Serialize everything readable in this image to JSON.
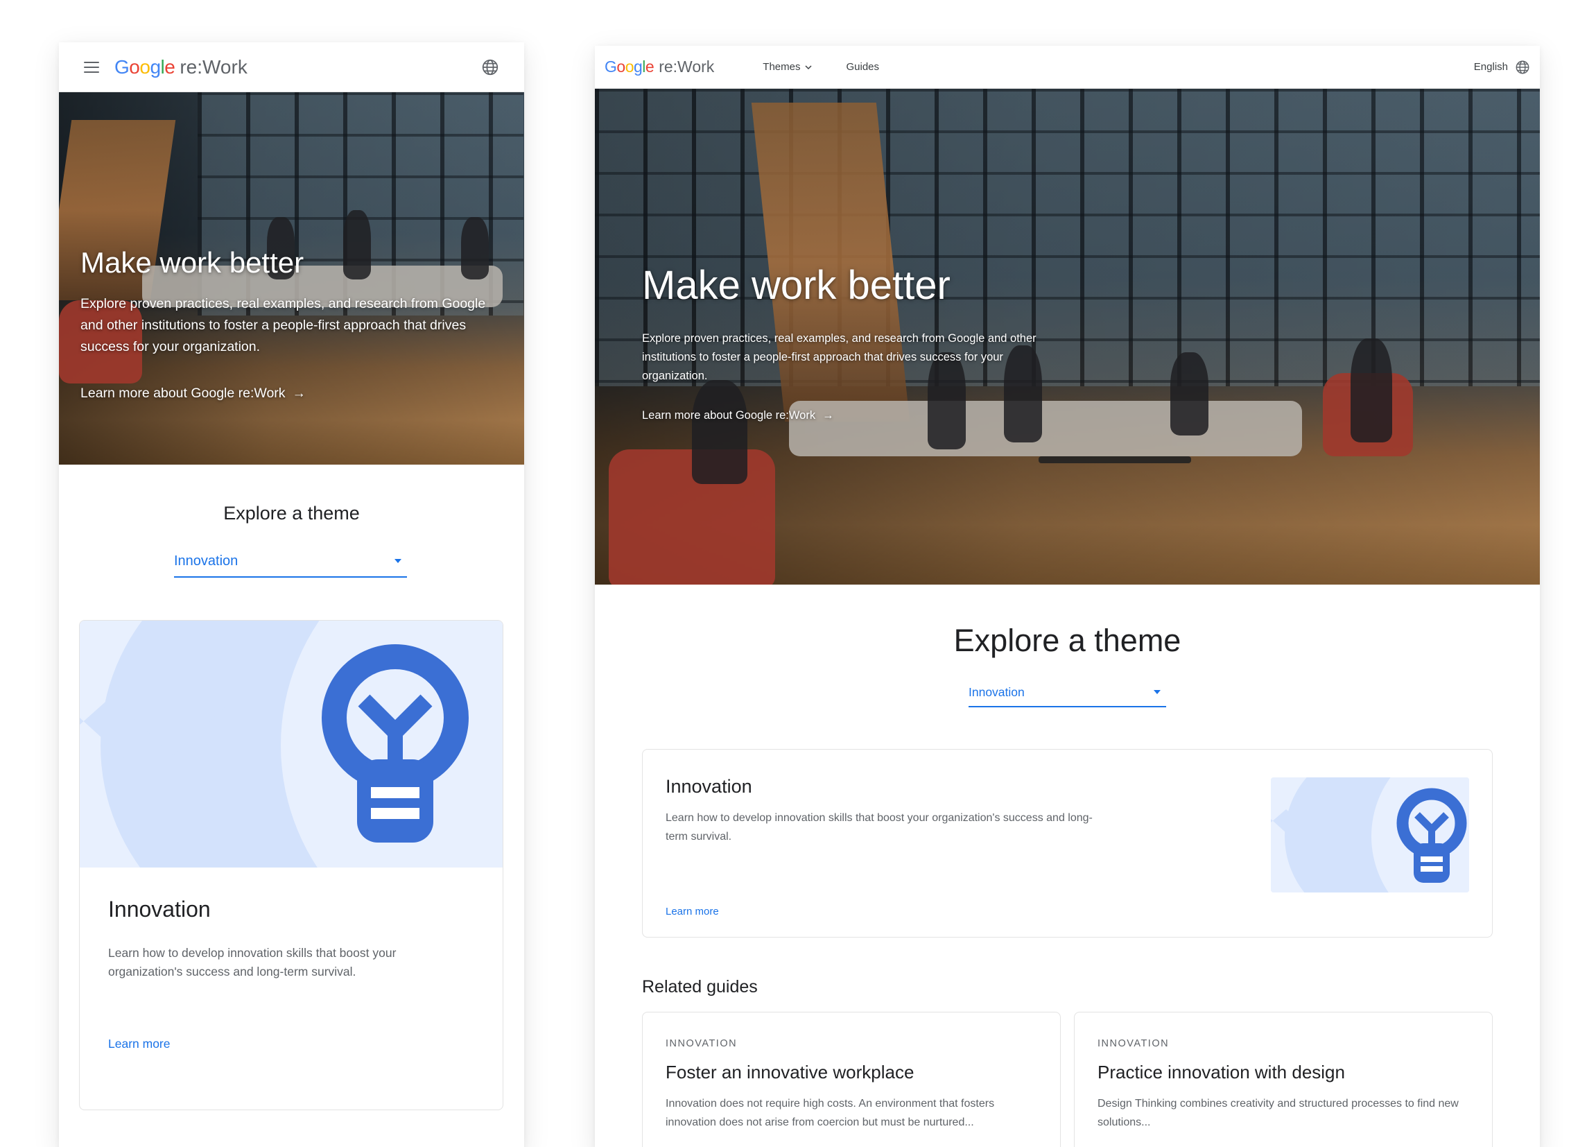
{
  "brand": {
    "logo_google": "Google",
    "logo_suffix": "re:Work",
    "google_colors": [
      "#4285F4",
      "#EA4335",
      "#FBBC05",
      "#4285F4",
      "#34A853",
      "#EA4335"
    ]
  },
  "nav": {
    "themes_label": "Themes",
    "guides_label": "Guides",
    "language_label": "English"
  },
  "hero": {
    "title": "Make work better",
    "description": "Explore proven practices, real examples, and research from Google and other institutions to foster a people-first approach that drives success for your organization.",
    "link_label": "Learn more about Google re:Work",
    "link_arrow": "→"
  },
  "explore": {
    "title": "Explore a theme",
    "selected_theme": "Innovation"
  },
  "theme_card": {
    "title": "Innovation",
    "description": "Learn how to develop innovation skills that boost your organization's success and long-term survival.",
    "learn_more": "Learn more",
    "icon": "lightbulb-icon"
  },
  "related": {
    "title": "Related guides",
    "guides": [
      {
        "category": "INNOVATION",
        "title": "Foster an innovative workplace",
        "description": "Innovation does not require high costs. An environment that fosters innovation does not arise from coercion but must be nurtured..."
      },
      {
        "category": "INNOVATION",
        "title": "Practice innovation with design",
        "description": "Design Thinking combines creativity and structured processes to find new solutions..."
      }
    ]
  },
  "colors": {
    "accent_blue": "#1a73e8",
    "illustration_light": "#e8f0fe",
    "illustration_icon": "#3b6fd4"
  }
}
